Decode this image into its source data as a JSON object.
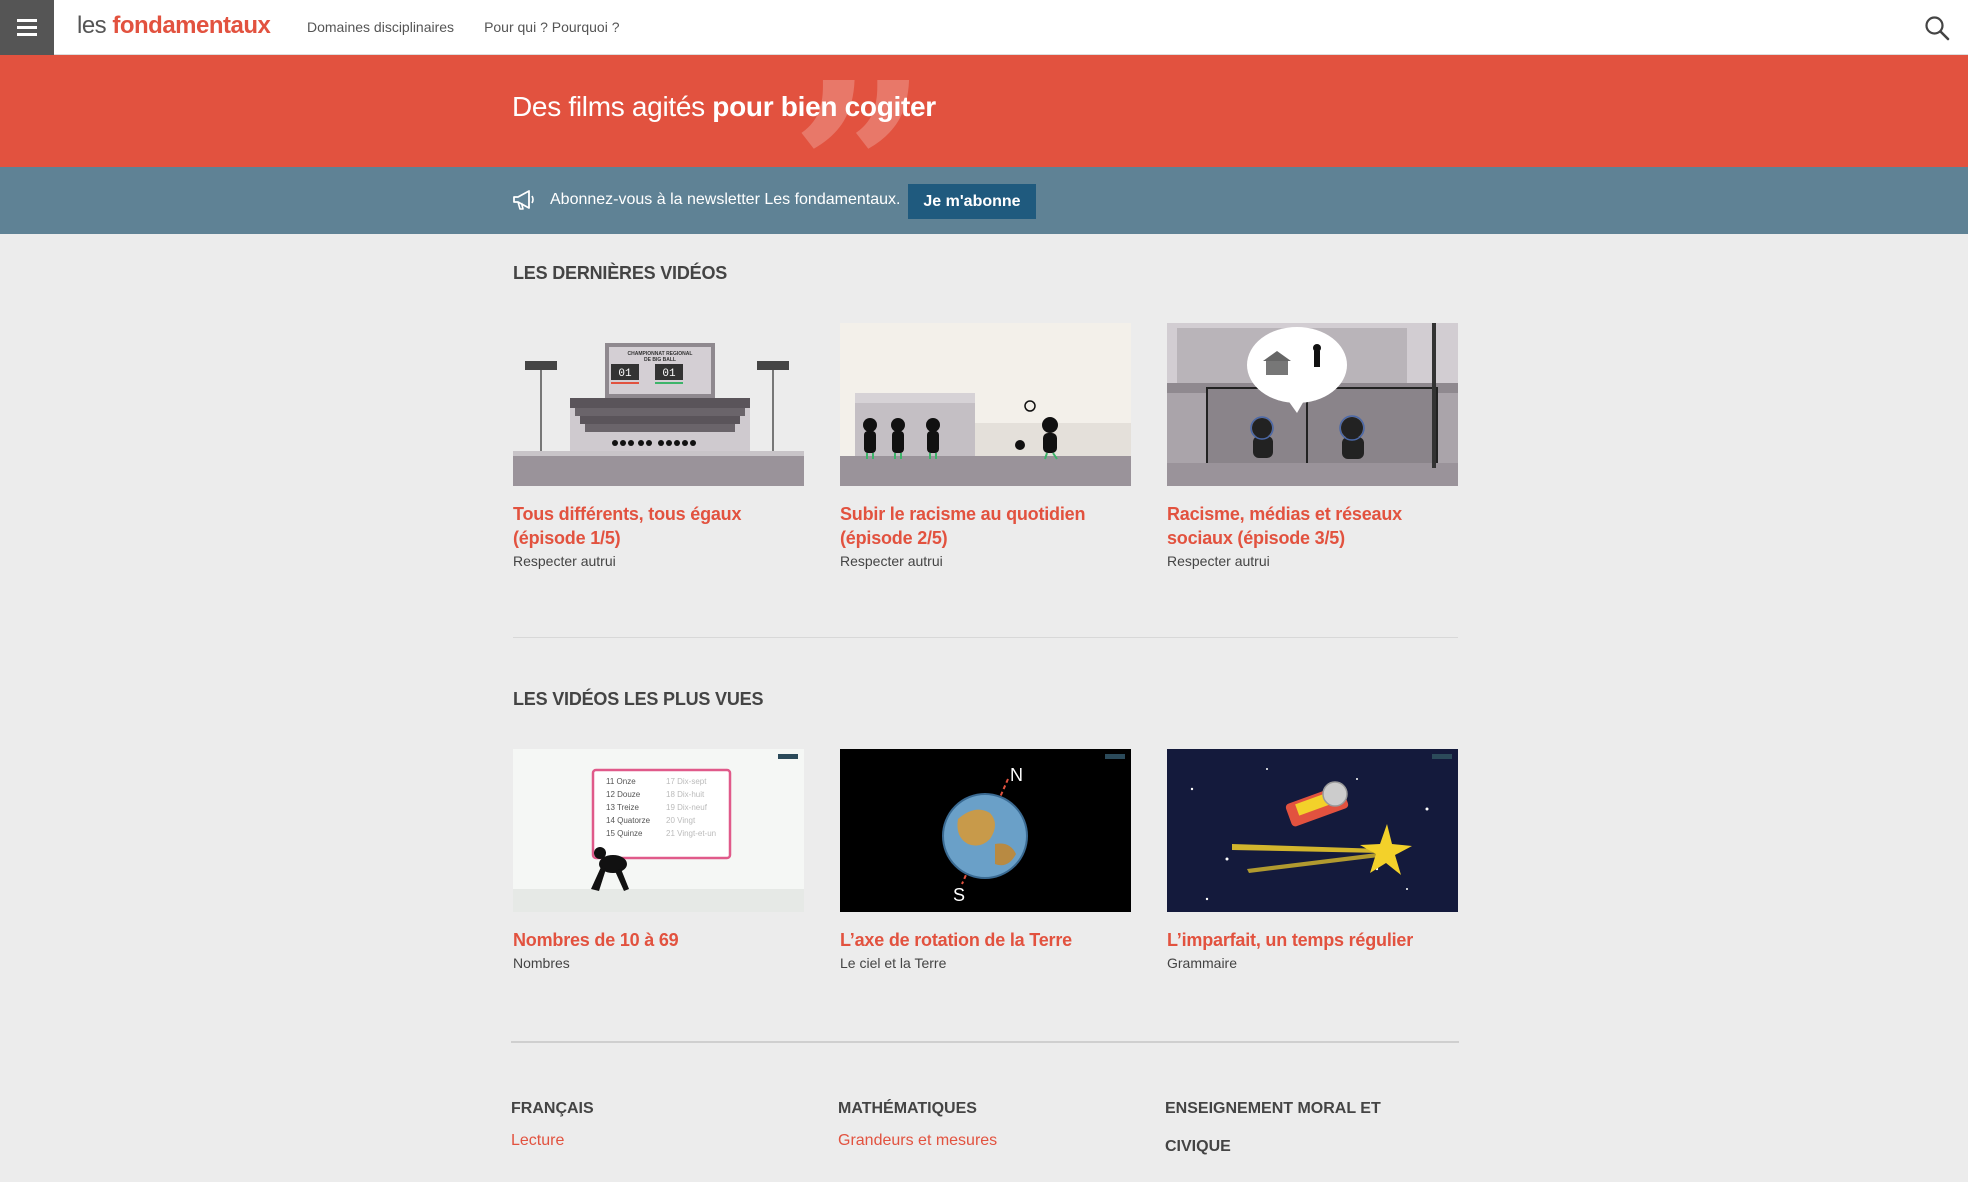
{
  "header": {
    "logo_prefix": "les",
    "logo_brand": "fondamentaux",
    "nav": [
      "Domaines disciplinaires",
      "Pour qui ? Pourquoi ?"
    ]
  },
  "hero": {
    "title_light": "Des films agités ",
    "title_bold": "pour bien cogiter"
  },
  "newsletter": {
    "text": "Abonnez-vous à la newsletter Les fondamentaux.",
    "button": "Je m'abonne"
  },
  "latest": {
    "title": "LES DERNIÈRES VIDÉOS",
    "items": [
      {
        "title": "Tous différents, tous égaux (épisode 1/5)",
        "category": "Respecter autrui"
      },
      {
        "title": "Subir le racisme au quotidien (épisode 2/5)",
        "category": "Respecter autrui"
      },
      {
        "title": "Racisme, médias et réseaux sociaux (épisode 3/5)",
        "category": "Respecter autrui"
      }
    ]
  },
  "popular": {
    "title": "LES VIDÉOS LES PLUS VUES",
    "items": [
      {
        "title": "Nombres de 10 à 69",
        "category": "Nombres"
      },
      {
        "title": "L’axe de rotation de la Terre",
        "category": "Le ciel et la Terre"
      },
      {
        "title": "L’imparfait, un temps régulier",
        "category": "Grammaire"
      }
    ]
  },
  "thumbs": {
    "scoreboard": {
      "line1": "CHAMPIONNAT REGIONAL",
      "line2": "DE BIG BALL",
      "left": "01",
      "right": "01"
    },
    "numbers": [
      "11 Onze",
      "12 Douze",
      "13 Treize",
      "14 Quatorze",
      "15 Quinze",
      "17 Dix-sept",
      "18 Dix-huit",
      "19 Dix-neuf",
      "20 Vingt",
      "21 Vingt-et-un"
    ],
    "compass": {
      "north": "N",
      "south": "S"
    }
  },
  "footer": {
    "columns": [
      {
        "title": "FRANÇAIS",
        "link": "Lecture"
      },
      {
        "title": "MATHÉMATIQUES",
        "link": "Grandeurs et mesures"
      },
      {
        "title": "ENSEIGNEMENT MORAL ET CIVIQUE",
        "link": ""
      }
    ]
  },
  "colors": {
    "accent": "#e2523f",
    "banner": "#5f8295",
    "button": "#1f5a7e"
  }
}
